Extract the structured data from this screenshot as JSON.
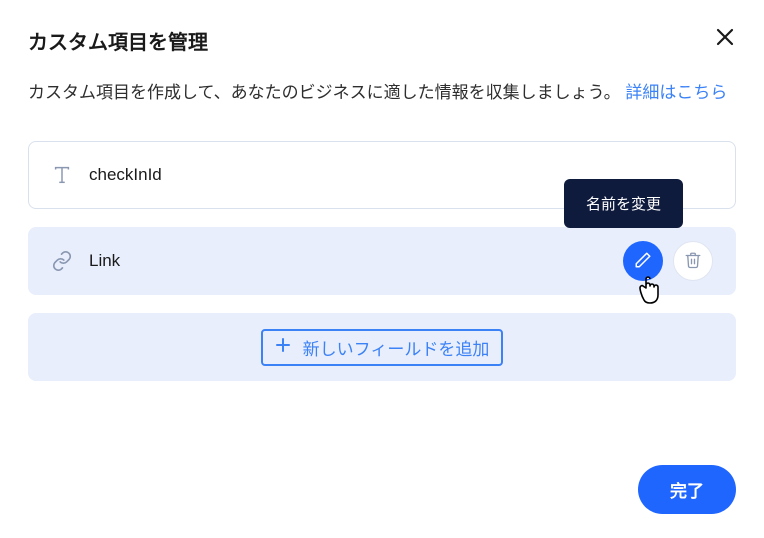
{
  "header": {
    "title": "カスタム項目を管理"
  },
  "description": {
    "text": "カスタム項目を作成して、あなたのビジネスに適した情報を収集しましょう。",
    "learn_more": "詳細はこちら"
  },
  "fields": [
    {
      "name": "checkInId",
      "icon": "text"
    },
    {
      "name": "Link",
      "icon": "link"
    }
  ],
  "tooltip": {
    "rename": "名前を変更"
  },
  "add_field_label": "新しいフィールドを追加",
  "footer": {
    "done": "完了"
  }
}
